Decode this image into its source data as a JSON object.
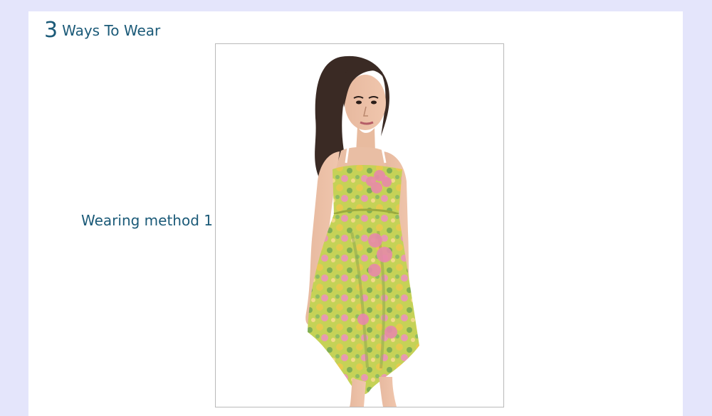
{
  "header": {
    "number": "3",
    "title": "Ways To Wear"
  },
  "wearing_method": {
    "label": "Wearing method 1"
  },
  "photo": {
    "subject": "woman-in-floral-strapless-dress",
    "dress_colors": [
      "#b8c94a",
      "#e8c84c",
      "#7fae55",
      "#e79bb0"
    ]
  },
  "colors": {
    "page_background": "#e4e5fb",
    "panel_background": "#ffffff",
    "text_accent": "#1b5a78",
    "frame_border": "#b9b9b9"
  }
}
